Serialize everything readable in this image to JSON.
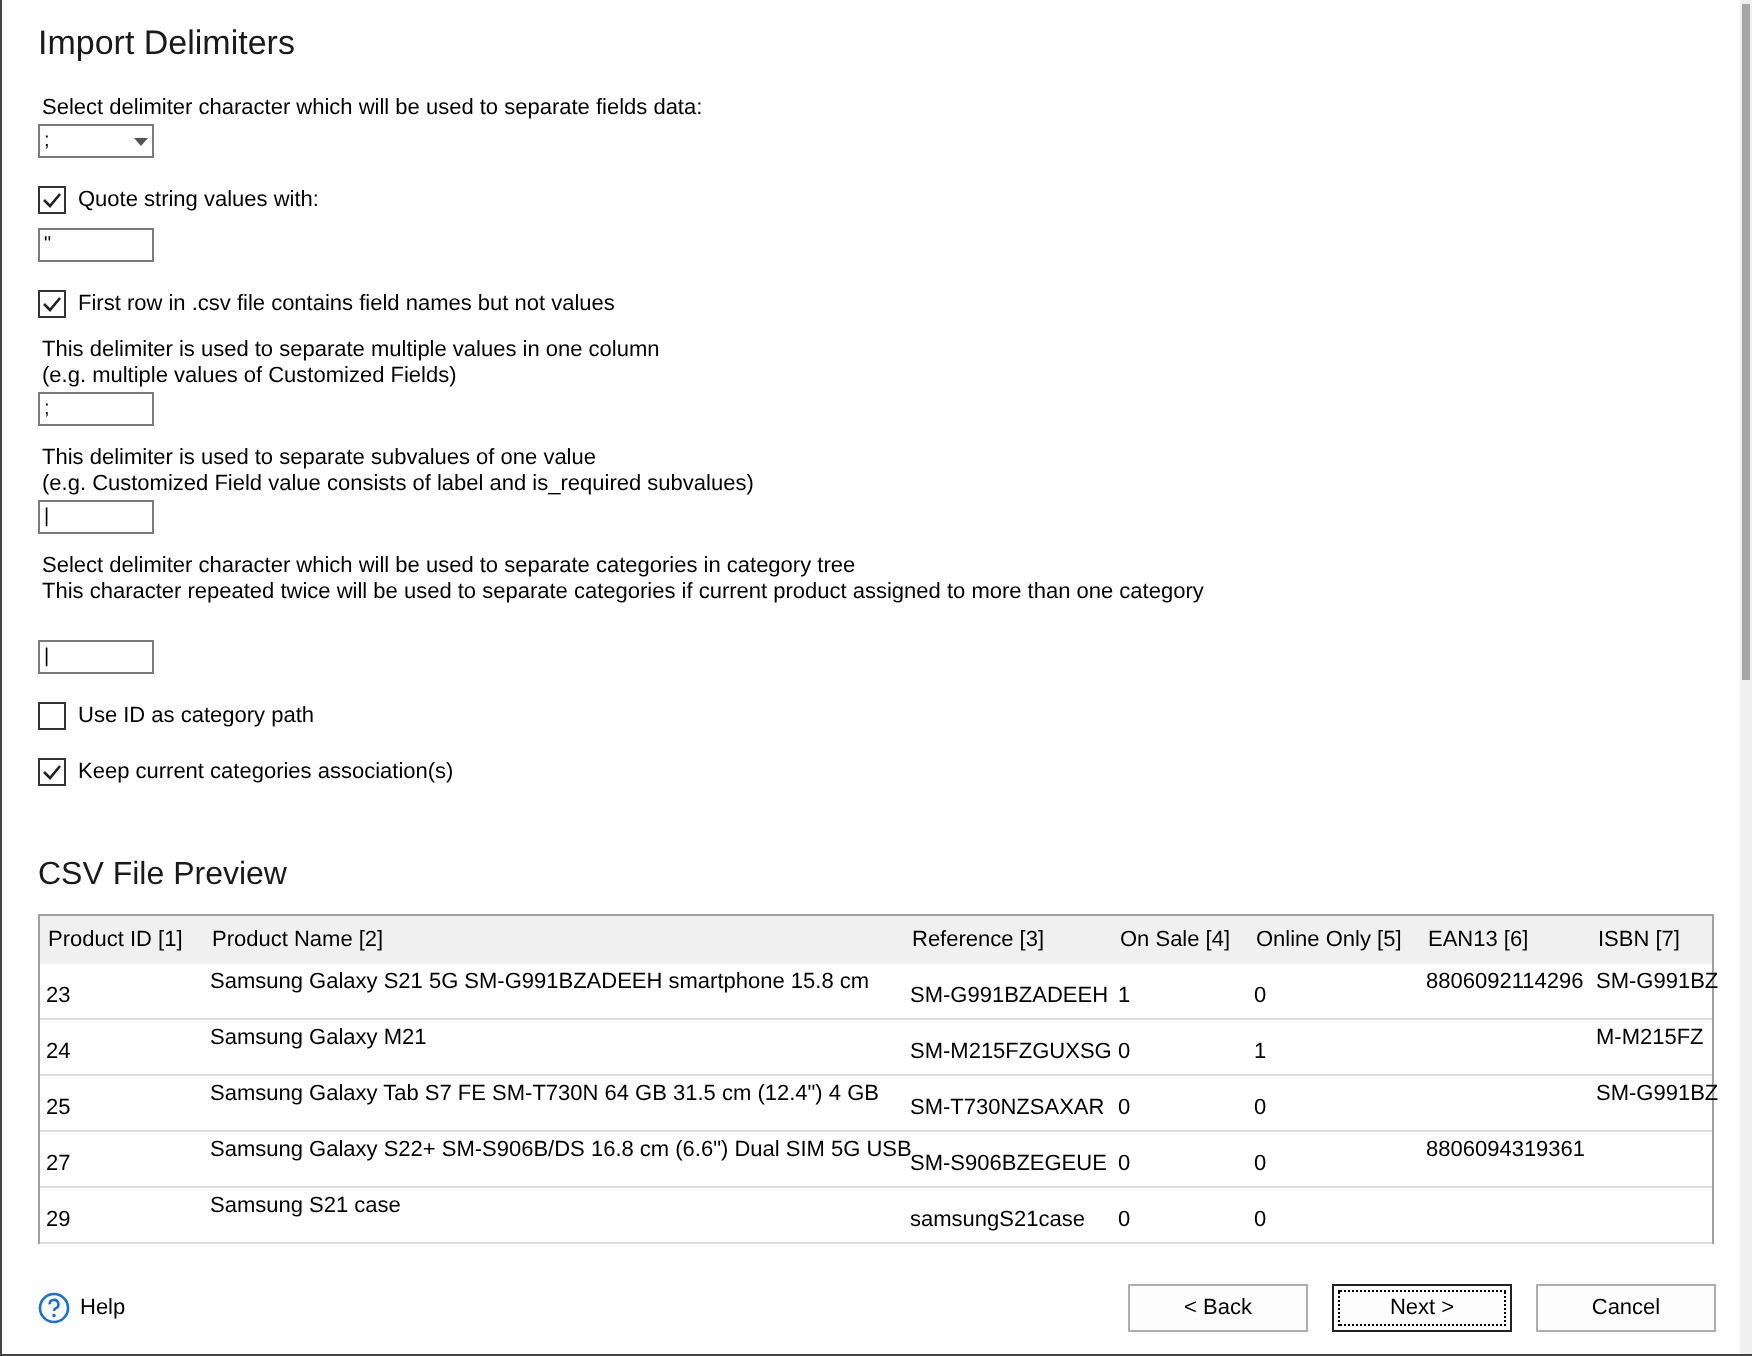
{
  "title": "Import Delimiters",
  "settings": [
    {
      "kind": "label",
      "lines": [
        "Select delimiter character which will be used to separate fields data:"
      ]
    },
    {
      "kind": "select",
      "value": ";"
    },
    {
      "kind": "checkbox",
      "label": "Quote string values with:",
      "checked": true
    },
    {
      "kind": "input",
      "value": "\""
    },
    {
      "kind": "checkbox",
      "label": "First row in .csv file contains field names but not values",
      "checked": true
    },
    {
      "kind": "label",
      "lines": [
        "This delimiter is used to separate multiple values in one column",
        "(e.g. multiple values of Customized Fields)"
      ]
    },
    {
      "kind": "input",
      "value": ";"
    },
    {
      "kind": "label",
      "lines": [
        "This delimiter is used to separate subvalues of one value",
        "(e.g. Customized Field value consists of label and is_required subvalues)"
      ]
    },
    {
      "kind": "input",
      "value": "|"
    },
    {
      "kind": "label",
      "lines": [
        "Select delimiter character which will be used to separate categories in category tree",
        "This character repeated twice will be used to separate categories if current product assigned to more than one category"
      ]
    },
    {
      "kind": "input",
      "value": "|"
    },
    {
      "kind": "checkbox",
      "label": "Use ID as category path",
      "checked": false
    },
    {
      "kind": "checkbox",
      "label": "Keep current categories association(s)",
      "checked": true
    }
  ],
  "preview": {
    "title": "CSV File Preview",
    "columns": [
      "Product ID [1]",
      "Product Name [2]",
      "Reference [3]",
      "On Sale [4]",
      "Online Only [5]",
      "EAN13 [6]",
      "ISBN [7]"
    ],
    "rows": [
      [
        "23",
        "Samsung Galaxy S21 5G SM-G991BZADEEH smartphone 15.8 cm",
        "SM-G991BZADEEH",
        "1",
        "0",
        "8806092114296",
        "SM-G991BZ"
      ],
      [
        "24",
        "Samsung Galaxy M21",
        "SM-M215FZGUXSG",
        "0",
        "1",
        "",
        "M-M215FZ"
      ],
      [
        "25",
        "Samsung Galaxy Tab S7 FE SM-T730N 64 GB 31.5 cm (12.4\") 4 GB",
        "SM-T730NZSAXAR",
        "0",
        "0",
        "",
        "SM-G991BZ"
      ],
      [
        "27",
        "Samsung Galaxy S22+ SM-S906B/DS 16.8 cm (6.6\") Dual SIM 5G USB",
        "SM-S906BZEGEUE",
        "0",
        "0",
        "8806094319361",
        ""
      ],
      [
        "29",
        "Samsung S21 case",
        "samsungS21case",
        "0",
        "0",
        "",
        ""
      ]
    ]
  },
  "help": "Help",
  "buttons": [
    {
      "label": "< Back",
      "focused": false
    },
    {
      "label": "Next >",
      "focused": true
    },
    {
      "label": "Cancel",
      "focused": false
    }
  ]
}
